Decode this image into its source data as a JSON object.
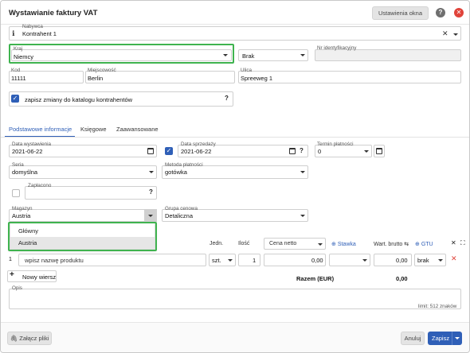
{
  "window": {
    "title": "Wystawianie faktury VAT",
    "settings_button": "Ustawienia okna"
  },
  "contractor": {
    "label": "Nabywca",
    "value": "Kontrahent 1"
  },
  "country": {
    "label": "Kraj",
    "value": "Niemcy"
  },
  "id_type": {
    "value": "Brak"
  },
  "tax_id": {
    "label": "Nr identyfikacyjny",
    "value": ""
  },
  "postal_code": {
    "label": "Kod",
    "value": "11111"
  },
  "city": {
    "label": "Miejscowość",
    "value": "Berlin"
  },
  "street": {
    "label": "Ulica",
    "value": "Spreeweg 1"
  },
  "save_changes": {
    "label": "zapisz zmiany do katalogu kontrahentów",
    "checked": true
  },
  "tabs": [
    {
      "label": "Podstawowe informacje",
      "active": true
    },
    {
      "label": "Księgowe",
      "active": false
    },
    {
      "label": "Zaawansowane",
      "active": false
    }
  ],
  "issue_date": {
    "label": "Data wystawienia",
    "value": "2021-06-22"
  },
  "sale_date": {
    "label": "Data sprzedaży",
    "value": "2021-06-22"
  },
  "payment_term": {
    "label": "Termin płatności",
    "value": "0"
  },
  "series": {
    "label": "Seria",
    "value": "domyślna"
  },
  "payment_method": {
    "label": "Metoda płatności",
    "value": "gotówka"
  },
  "paid": {
    "label": "Zapłacono",
    "value": ""
  },
  "warehouse": {
    "label": "Magazyn",
    "value": "Austria",
    "options": [
      "Główny",
      "Austria"
    ]
  },
  "price_group": {
    "label": "Grupa cenowa",
    "value": "Detaliczna"
  },
  "items_table": {
    "headers": {
      "unit": "Jedn.",
      "qty": "Ilość",
      "net_price": "Cena netto",
      "rate": "Stawka",
      "gross_value": "Wart. brutto",
      "gtu": "GTU"
    },
    "row": {
      "no": "1",
      "product_placeholder": "wpisz nazwę produktu",
      "unit": "szt.",
      "qty": "1",
      "net_price": "0,00",
      "gross_value": "0,00",
      "gtu": "brak"
    },
    "add_row": "Nowy wiersz",
    "total_label": "Razem (EUR)",
    "total_value": "0,00"
  },
  "description": {
    "label": "Opis",
    "limit": "limit: 512 znaków"
  },
  "footer": {
    "attach": "Załącz pliki",
    "cancel": "Anuluj",
    "save": "Zapisz"
  },
  "colors": {
    "accent": "#2f5fb7",
    "highlight": "#3fb34f",
    "danger": "#e0433a"
  }
}
